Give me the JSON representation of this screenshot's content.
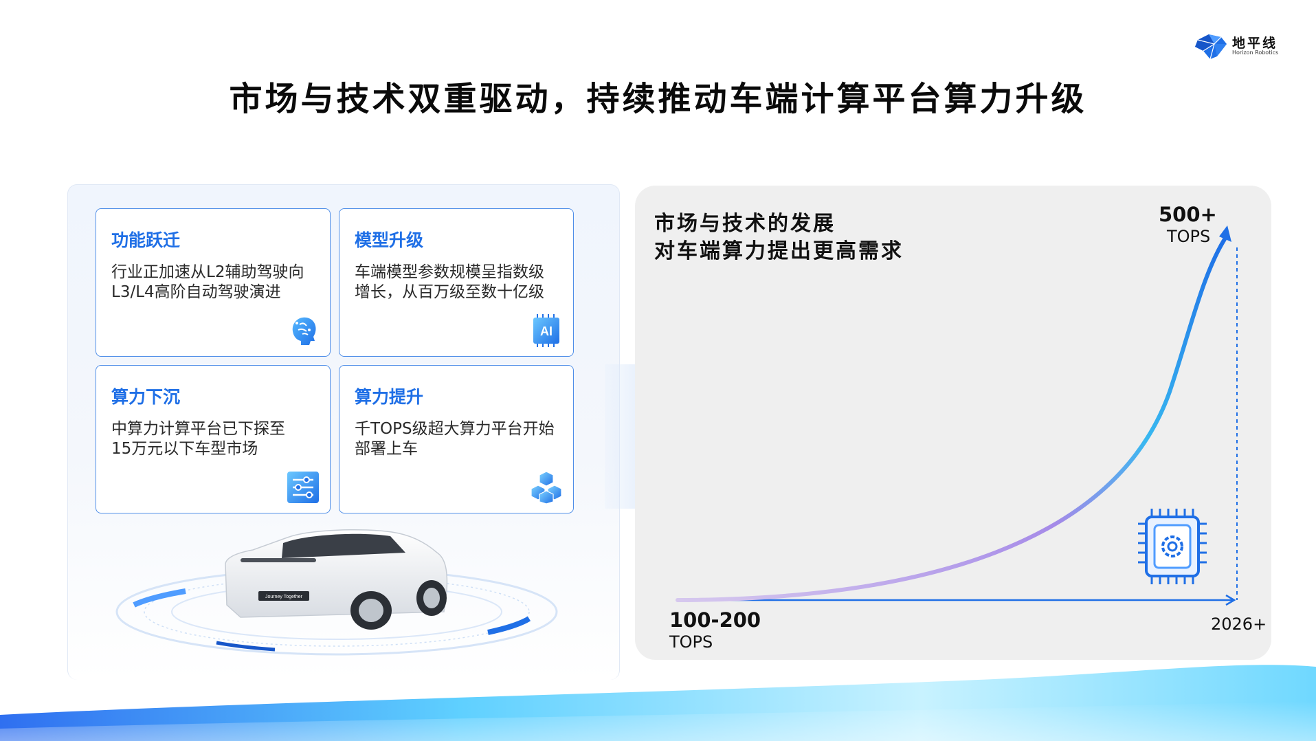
{
  "brand": {
    "name_cn": "地平线",
    "name_en": "Horizon Robotics",
    "color": "#1f6fe6"
  },
  "title": "市场与技术双重驱动，持续推动车端计算平台算力升级",
  "cards": [
    {
      "title": "功能跃迁",
      "desc_line1": "行业正加速从L2辅助驾驶向",
      "desc_line2": "L3/L4高阶自动驾驶演进",
      "icon": "brain-icon"
    },
    {
      "title": "模型升级",
      "desc_line1": "车端模型参数规模呈指数级",
      "desc_line2": "增长，从百万级至数十亿级",
      "icon": "ai-chip-icon"
    },
    {
      "title": "算力下沉",
      "desc_line1": "中算力计算平台已下探至",
      "desc_line2": "15万元以下车型市场",
      "icon": "sliders-icon"
    },
    {
      "title": "算力提升",
      "desc_line1": "千TOPS级超大算力平台开始",
      "desc_line2": "部署上车",
      "icon": "cubes-icon"
    }
  ],
  "car": {
    "plate_text": "Journey Together"
  },
  "chart": {
    "title_line1": "市场与技术的发展",
    "title_line2": "对车端算力提出更高需求",
    "start_value": "100-200",
    "start_unit": "TOPS",
    "end_value": "500+",
    "end_unit": "TOPS",
    "end_x_label": "2026+",
    "icon": "processor-gear-icon"
  },
  "chart_data": {
    "type": "line",
    "x": [
      "",
      "2026+"
    ],
    "series": [
      {
        "values": [
          150,
          500
        ]
      }
    ],
    "annotations": [
      "100-200 TOPS",
      "500+ TOPS"
    ]
  }
}
